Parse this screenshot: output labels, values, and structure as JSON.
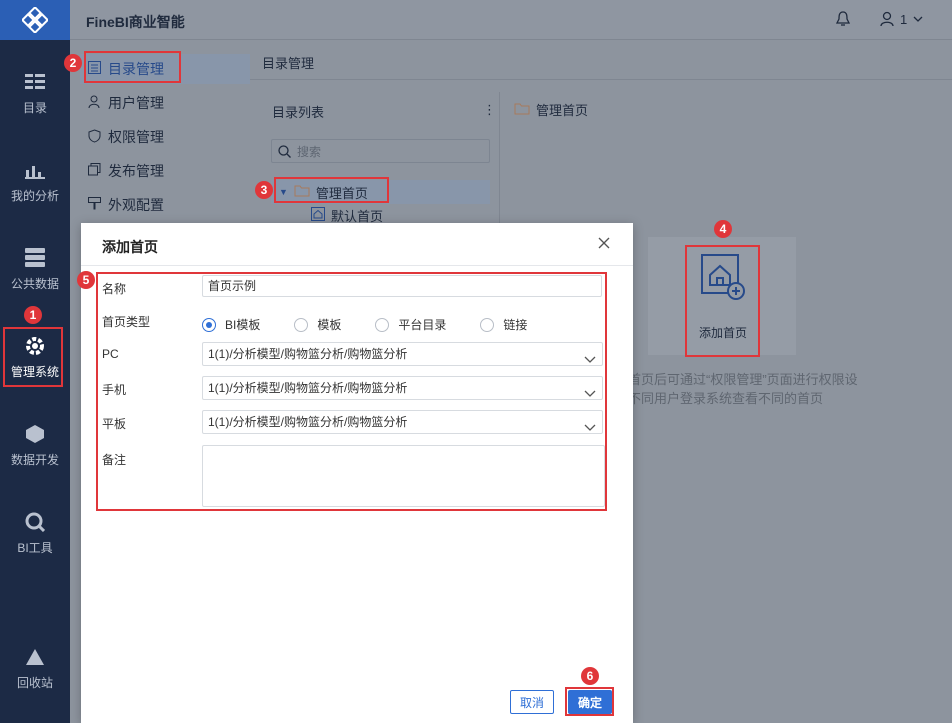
{
  "app": {
    "title": "FineBI商业智能",
    "user_name": "1"
  },
  "rail": [
    {
      "label": "目录",
      "icon": "catalog-icon"
    },
    {
      "label": "我的分析",
      "icon": "analysis-icon"
    },
    {
      "label": "公共数据",
      "icon": "database-icon"
    },
    {
      "label": "管理系统",
      "icon": "gear-icon"
    },
    {
      "label": "数据开发",
      "icon": "cube-icon"
    },
    {
      "label": "BI工具",
      "icon": "tools-icon"
    },
    {
      "label": "回收站",
      "icon": "recycle-icon"
    }
  ],
  "subnav": [
    {
      "label": "目录管理",
      "icon": "list-icon",
      "active": true
    },
    {
      "label": "用户管理",
      "icon": "user-icon"
    },
    {
      "label": "权限管理",
      "icon": "shield-icon"
    },
    {
      "label": "发布管理",
      "icon": "copy-icon"
    },
    {
      "label": "外观配置",
      "icon": "brush-icon"
    }
  ],
  "main": {
    "header": "目录管理",
    "list_title": "目录列表",
    "search_placeholder": "搜索",
    "tree_folder": "管理首页",
    "tree_child": "默认首页",
    "right_title": "管理首页",
    "add_label": "添加首页",
    "hint_line1": "首页后可通过“权限管理”页面进行权限设",
    "hint_line2": "不同用户登录系统查看不同的首页"
  },
  "dialog": {
    "title": "添加首页",
    "name_label": "名称",
    "name_value": "首页示例",
    "type_label": "首页类型",
    "type_options": [
      "BI模板",
      "模板",
      "平台目录",
      "链接"
    ],
    "type_selected": "BI模板",
    "pc_label": "PC",
    "pc_value": "1(1)/分析模型/购物篮分析/购物篮分析",
    "mobile_label": "手机",
    "mobile_value": "1(1)/分析模型/购物篮分析/购物篮分析",
    "tablet_label": "平板",
    "tablet_value": "1(1)/分析模型/购物篮分析/购物篮分析",
    "note_label": "备注",
    "cancel": "取消",
    "confirm": "确定"
  },
  "badges": [
    "1",
    "2",
    "3",
    "4",
    "5",
    "6"
  ],
  "colors": {
    "accent": "#2f6fd6",
    "rail": "#1c2a45",
    "annotation": "#e0363a"
  }
}
